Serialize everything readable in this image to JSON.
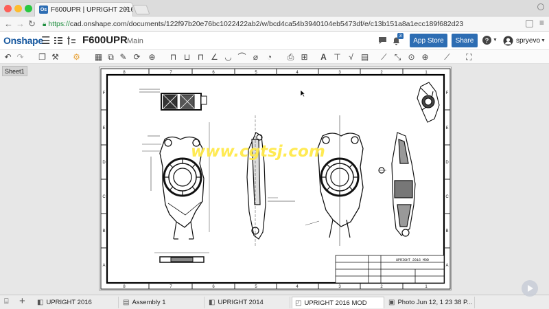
{
  "browser": {
    "tab_title": "F600UPR | UPRIGHT 2016 MO",
    "tab_favicon": "Os",
    "url_scheme": "https://",
    "url_rest": "cad.onshape.com/documents/122f97b20e76bc1022422ab2/w/bcd4ca54b3940104eb5473df/e/c13b151a8a1ecc189f682d23"
  },
  "header": {
    "logo": "Onshape",
    "doc_name": "F600UPR",
    "branch": "Main",
    "notif_count": "3",
    "app_store": "App Store",
    "share": "Share",
    "user": "spryevo"
  },
  "workspace": {
    "sheet_tab": "Sheet1",
    "watermark": "www.cgtsj.com"
  },
  "drawing": {
    "col_labels": [
      "8",
      "7",
      "6",
      "5",
      "4",
      "3",
      "2",
      "1"
    ],
    "row_labels": [
      "F",
      "E",
      "D",
      "C",
      "B",
      "A"
    ],
    "title_block": "UPRIGHT 2016 MOD"
  },
  "bottom_tabs": [
    {
      "label": "UPRIGHT 2016",
      "icon": "part-studio-icon"
    },
    {
      "label": "Assembly 1",
      "icon": "assembly-icon"
    },
    {
      "label": "UPRIGHT 2014",
      "icon": "part-studio-icon"
    },
    {
      "label": "UPRIGHT 2016 MOD",
      "icon": "drawing-icon"
    },
    {
      "label": "Photo Jun 12, 1 23 38 P...",
      "icon": "image-icon"
    }
  ],
  "colors": {
    "onshape_blue": "#2d6db3",
    "watermark": "#ffe94a"
  }
}
